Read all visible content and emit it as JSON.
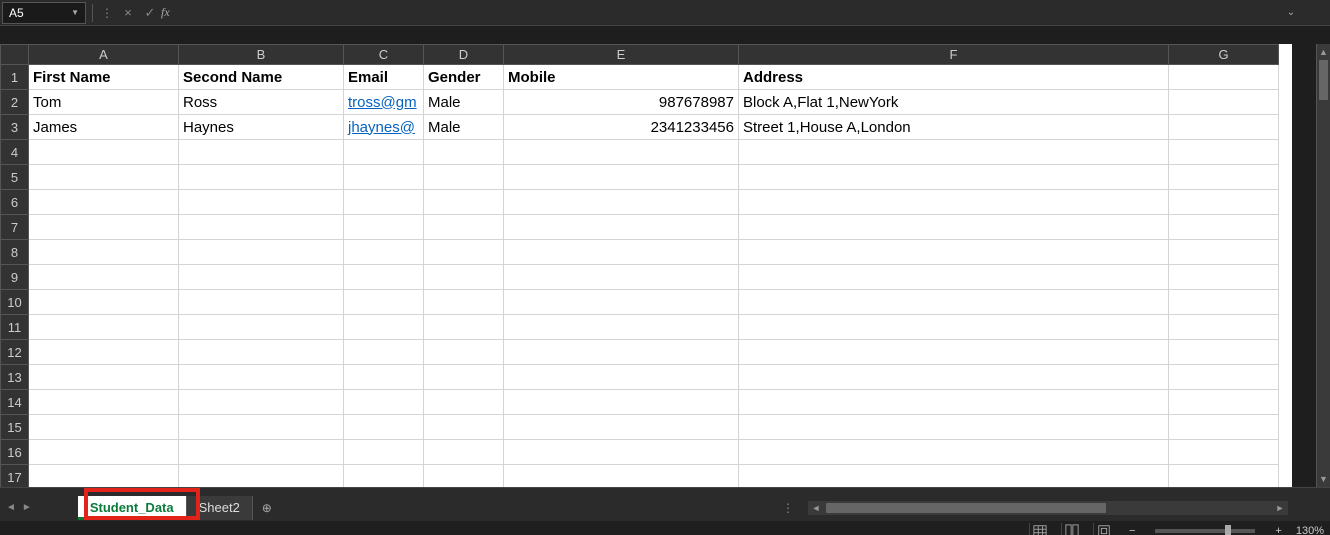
{
  "formula_bar": {
    "name_box": "A5",
    "cancel_tip": "×",
    "confirm_tip": "✓",
    "fx_label": "fx",
    "formula_value": ""
  },
  "columns": [
    "A",
    "B",
    "C",
    "D",
    "E",
    "F",
    "G"
  ],
  "row_numbers": [
    "1",
    "2",
    "3",
    "4",
    "5",
    "6",
    "7",
    "8",
    "9",
    "10",
    "11",
    "12",
    "13",
    "14",
    "15",
    "16",
    "17"
  ],
  "headers": {
    "A": "First Name",
    "B": "Second Name",
    "C": "Email",
    "D": "Gender",
    "E": "Mobile",
    "F": "Address"
  },
  "rows": [
    {
      "A": "Tom",
      "B": "Ross",
      "C": "tross@gm",
      "D": "Male",
      "E": "987678987",
      "F": "Block A,Flat 1,NewYork"
    },
    {
      "A": "James",
      "B": "Haynes",
      "C": "jhaynes@",
      "D": "Male",
      "E": "2341233456",
      "F": "Street 1,House A,London"
    }
  ],
  "tabs": {
    "active": "Student_Data",
    "others": [
      "Sheet2"
    ]
  },
  "status": {
    "zoom": "130%"
  }
}
